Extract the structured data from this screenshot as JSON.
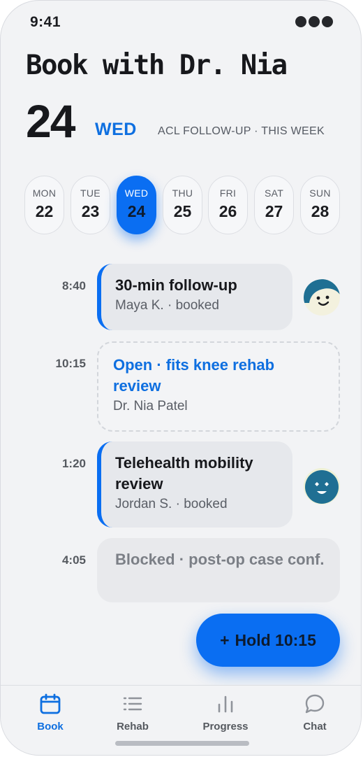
{
  "status": {
    "time": "9:41"
  },
  "header": {
    "title": "Book with Dr. Nia",
    "date_number": "24",
    "day_label": "WED",
    "context": "ACL FOLLOW-UP · THIS WEEK"
  },
  "week": [
    {
      "dow": "MON",
      "num": "22",
      "selected": false
    },
    {
      "dow": "TUE",
      "num": "23",
      "selected": false
    },
    {
      "dow": "WED",
      "num": "24",
      "selected": true
    },
    {
      "dow": "THU",
      "num": "25",
      "selected": false
    },
    {
      "dow": "FRI",
      "num": "26",
      "selected": false
    },
    {
      "dow": "SAT",
      "num": "27",
      "selected": false
    },
    {
      "dow": "SUN",
      "num": "28",
      "selected": false
    }
  ],
  "slots": [
    {
      "time": "8:40",
      "title": "30-min follow-up",
      "subtitle": "Maya K. · booked",
      "type": "booked"
    },
    {
      "time": "10:15",
      "title": "Open · fits knee rehab review",
      "subtitle": "Dr. Nia Patel",
      "type": "open"
    },
    {
      "time": "1:20",
      "title": "Telehealth mobility review",
      "subtitle": "Jordan S. · booked",
      "type": "booked"
    },
    {
      "time": "4:05",
      "title": "Blocked · post-op case conf.",
      "subtitle": "",
      "type": "blocked"
    }
  ],
  "fab": {
    "plus": "+",
    "label": "Hold 10:15"
  },
  "nav": [
    {
      "label": "Book",
      "icon": "calendar-icon",
      "active": true
    },
    {
      "label": "Rehab",
      "icon": "list-icon",
      "active": false
    },
    {
      "label": "Progress",
      "icon": "bar-chart-icon",
      "active": false
    },
    {
      "label": "Chat",
      "icon": "chat-bubble-icon",
      "active": false
    }
  ],
  "colors": {
    "accent": "#0a6ef2",
    "background": "#f2f3f5",
    "card": "#e6e8ec"
  }
}
